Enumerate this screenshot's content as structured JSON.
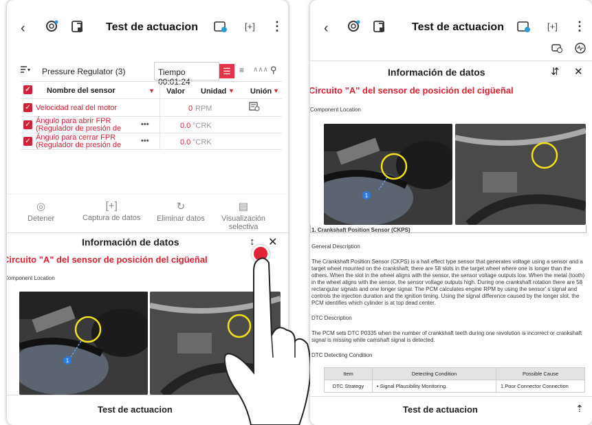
{
  "header": {
    "title": "Test de actuacion",
    "back_icon": "chevron-left-icon",
    "icons": [
      "gear-icon",
      "export-icon",
      "obd-icon",
      "capture-icon",
      "more-icon"
    ]
  },
  "sensor_list": {
    "group_label": "Pressure Regulator (3)",
    "timer": "Tiempo 00:01:24",
    "columns": {
      "name": "Nombre del sensor",
      "value": "Valor",
      "unit": "Unidad",
      "union": "Unión"
    },
    "rows": [
      {
        "name": "Velocidad real del motor",
        "value": "0",
        "unit": "RPM"
      },
      {
        "name": "Ángulo para abrir FPR (Regulador de presión de",
        "value": "0.0",
        "unit": "°CRK"
      },
      {
        "name": "Ángulo para cerrar FPR (Regulador de presión de",
        "value": "0.0",
        "unit": "°CRK"
      }
    ]
  },
  "actions": {
    "stop": "Detener",
    "capture": "Captura de datos",
    "delete": "Eliminar datos",
    "selective_1": "Visualización",
    "selective_2": "selectiva"
  },
  "info_panel": {
    "title": "Información de datos",
    "subtitle": "Circuito \"A\" del sensor de posición del cigüeñal",
    "subtitle_cut": "Circuito \"A\" del sensor de posición del cigüeñal",
    "component_location": "Component Location",
    "caption": "1. Crankshaft Position Sensor (CKPS)",
    "general_description_heading": "General Description",
    "general_description": "The Crankshaft Position Sensor (CKPS) is a hall effect type sensor that generates voltage using a sensor and a target wheel mounted on the crankshaft; there are 58 slots in the target wheel where one is longer than the others. When the slot in the wheel aligns with the sensor, the sensor voltage outputs low. When the metal (tooth) in the wheel aligns with the sensor, the sensor voltage outputs high. During one crankshaft rotation there are 58 rectangular signals and one longer signal. The PCM calculates engine RPM by using the sensor' s signal and controls the injection duration and the ignition timing. Using the signal difference caused by the longer slot, the PCM identifies which cylinder is at top dead center.",
    "dtc_description_heading": "DTC Description",
    "dtc_description": "The PCM sets DTC P0335 when the number of crankshaft teeth during one revolution is incorrect or crankshaft signal is missing while camshaft signal is detected.",
    "dtc_detecting_heading": "DTC Detecting Condition",
    "dtc_table": {
      "headers": [
        "Item",
        "Detecting Condition",
        "Possible Cause"
      ],
      "row": [
        "DTC Strategy",
        "• Signal Plausibility Monitoring.",
        "1.Poor Connector Connection"
      ]
    },
    "marker_number": "1"
  },
  "footer": {
    "title": "Test de actuacion"
  },
  "colors": {
    "accent": "#e01f30",
    "checkbox": "#d32236"
  }
}
